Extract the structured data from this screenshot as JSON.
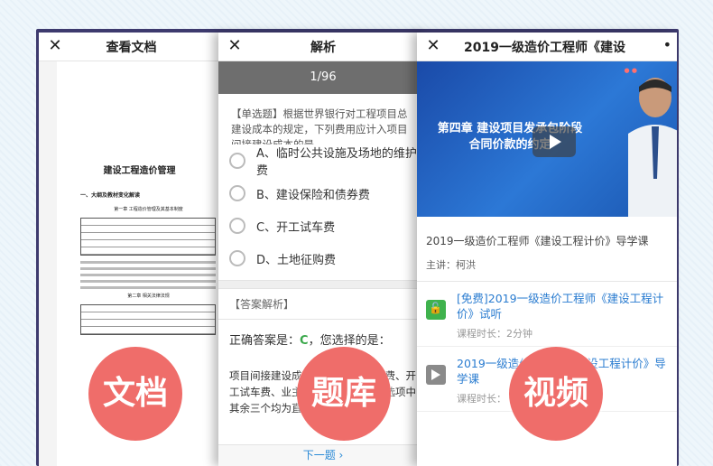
{
  "doc_panel": {
    "close_icon": "close-icon",
    "title": "查看文档",
    "doc_heading": "建设工程造价管理",
    "section": "一、大纲及教材变化解读",
    "chapter1": "第一章 工程造价管理及其基本制度",
    "chapter2": "第二章 相关法律法规",
    "badge": "文档"
  },
  "quiz_panel": {
    "title": "解析",
    "progress": "1/96",
    "question": "【单选题】根据世界银行对工程项目总建设成本的规定，下列费用应计入项目间接建设成本的是",
    "options": [
      "A、临时公共设施及场地的维护费",
      "B、建设保险和债券费",
      "C、开工试车费",
      "D、土地征购费"
    ],
    "answer_section": "【答案解析】",
    "answer_prefix": "正确答案是：",
    "answer_letter": "C",
    "answer_suffix": "，您选择的是：",
    "explanation": "项目间接建设成本包括：项目管理费、开工试车费、业主的行政性费用……选项中其余三个均为直接建设成本。",
    "next": "下一题 ›",
    "badge": "题库"
  },
  "video_panel": {
    "title": "2019一级造价工程师《建设",
    "more_icon": "more-icon",
    "video_title_line1": "第四章 建设项目发承包阶段",
    "video_title_line2": "合同价款的约定",
    "course": "2019一级造价工程师《建设工程计价》导学课",
    "teacher": "主讲：柯洪",
    "lessons": [
      {
        "title": "[免费]2019一级造价工程师《建设工程计价》试听",
        "meta": "课程时长：2分钟"
      },
      {
        "title": "2019一级造价工程师《建设工程计价》导学课",
        "meta": "课程时长："
      }
    ],
    "badge": "视频"
  },
  "colors": {
    "frame": "#3d3a6e",
    "badge": "#ef6d6a",
    "link": "#2a7cd0",
    "correct": "#3aa84b"
  }
}
